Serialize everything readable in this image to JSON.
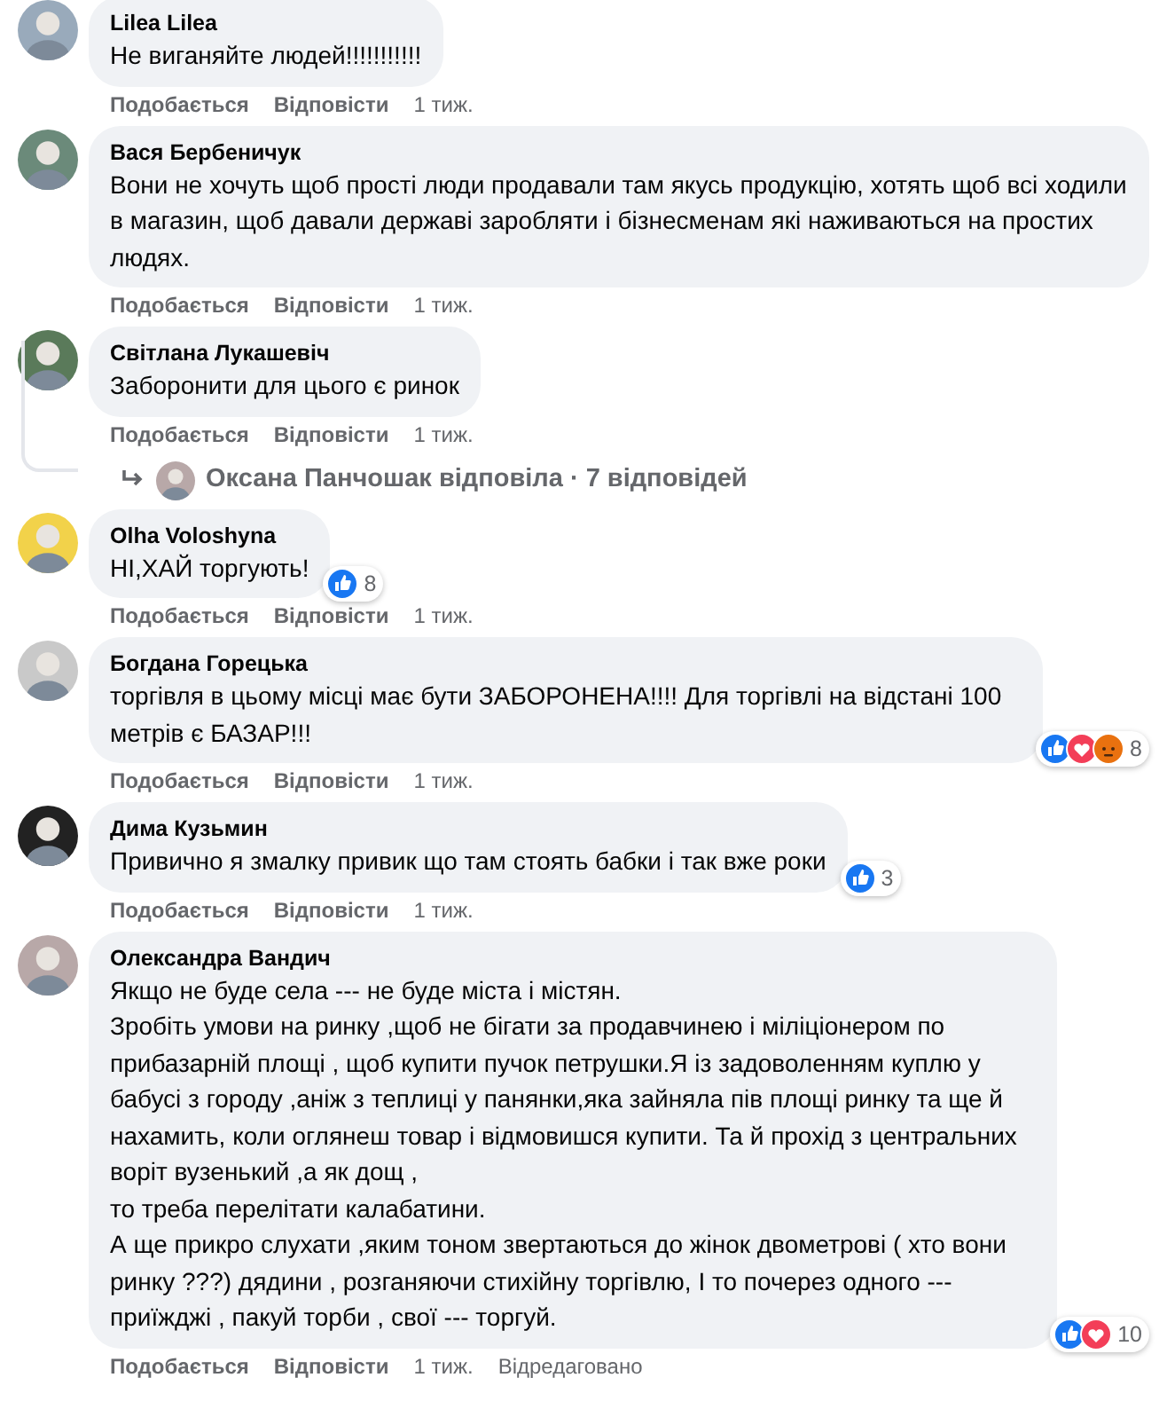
{
  "comments": [
    {
      "author": "Lilea Lilea",
      "paragraphs": [
        "Не виганяйте людей!!!!!!!!!!!"
      ],
      "actions": {
        "like": "Подобається",
        "reply": "Відповісти",
        "time": "1 тиж."
      }
    },
    {
      "author": "Вася Бербеничук",
      "paragraphs": [
        "Вони не хочуть щоб прості люди продавали там якусь продукцію, хотять щоб всі ходили в магазин, щоб давали державі заробляти і бізнесменам які наживаються на простих людях."
      ],
      "actions": {
        "like": "Подобається",
        "reply": "Відповісти",
        "time": "1 тиж."
      }
    },
    {
      "author": "Світлана Лукашевіч",
      "paragraphs": [
        "Заборонити для цього є ринок"
      ],
      "actions": {
        "like": "Подобається",
        "reply": "Відповісти",
        "time": "1 тиж."
      },
      "replies_link": {
        "text": "Оксана Панчошак відповіла · 7 відповідей"
      }
    },
    {
      "author": "Olha Voloshyna",
      "paragraphs": [
        "НІ,ХАЙ торгують!"
      ],
      "reactions": {
        "types": [
          {
            "kind": "like"
          }
        ],
        "count": "8"
      },
      "actions": {
        "like": "Подобається",
        "reply": "Відповісти",
        "time": "1 тиж."
      }
    },
    {
      "author": "Богдана Горецька",
      "paragraphs": [
        "торгівля в цьому місці має бути ЗАБОРОНЕНА!!!! Для торгівлі на відстані 100 метрів є БАЗАР!!!"
      ],
      "reactions": {
        "types": [
          {
            "kind": "like"
          },
          {
            "kind": "love"
          },
          {
            "kind": "angry"
          }
        ],
        "count": "8"
      },
      "actions": {
        "like": "Подобається",
        "reply": "Відповісти",
        "time": "1 тиж."
      }
    },
    {
      "author": "Дима Кузьмин",
      "paragraphs": [
        "Привично я змалку привик що там стоять бабки і так вже роки"
      ],
      "reactions": {
        "types": [
          {
            "kind": "like"
          }
        ],
        "count": "3"
      },
      "actions": {
        "like": "Подобається",
        "reply": "Відповісти",
        "time": "1 тиж."
      }
    },
    {
      "author": "Олександра Вандич",
      "paragraphs": [
        "Якщо не буде села --- не буде міста і містян.",
        "Зробіть умови на ринку ,щоб не бігати за продавчинею і міліціонером по прибазарній площі , щоб купити пучок петрушки.Я із задоволенням куплю у бабусі з городу ,аніж з теплиці у панянки,яка зайняла пів площі ринку та ще й нахамить, коли оглянеш товар і відмовишся купити. Та й прохід з центральних воріт вузенький ,а як дощ ,",
        "то треба перелітати калабатини.",
        "А ще прикро слухати ,яким тоном звертаються до жінок двометрові ( хто вони ринку ???) дядини , розганяючи стихійну торгівлю, І то почерез одного --- приїжджі , пакуй торби , свої --- торгуй."
      ],
      "reactions": {
        "types": [
          {
            "kind": "like"
          },
          {
            "kind": "love"
          }
        ],
        "count": "10"
      },
      "actions": {
        "like": "Подобається",
        "reply": "Відповісти",
        "time": "1 тиж.",
        "edited": "Відредаговано"
      }
    }
  ]
}
